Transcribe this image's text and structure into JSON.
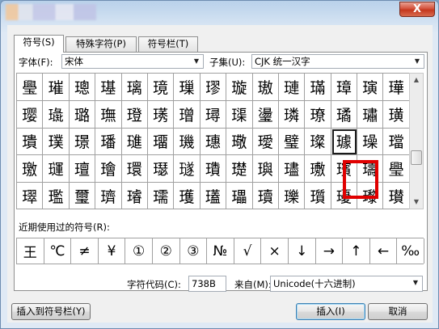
{
  "window": {
    "close_glyph": "X"
  },
  "tabs": [
    {
      "label": "符号(S)"
    },
    {
      "label": "特殊字符(P)"
    },
    {
      "label": "符号栏(T)"
    }
  ],
  "font": {
    "label": "字体(F):",
    "value": "宋体"
  },
  "subset": {
    "label": "子集(U):",
    "value": "CJK 统一汉字"
  },
  "symbols": [
    [
      "璺",
      "璀",
      "璁",
      "璂",
      "璃",
      "璄",
      "璅",
      "璆",
      "璇",
      "璈",
      "璉",
      "璊",
      "璋",
      "璌",
      "璍"
    ],
    [
      "璎",
      "璏",
      "璐",
      "璑",
      "璒",
      "璓",
      "璔",
      "璕",
      "璖",
      "璗",
      "璘",
      "璙",
      "璚",
      "璛",
      "璜"
    ],
    [
      "璝",
      "璞",
      "璟",
      "璠",
      "璡",
      "璢",
      "璣",
      "璤",
      "璥",
      "璦",
      "璧",
      "璨",
      "璩",
      "璪",
      "璫"
    ],
    [
      "璬",
      "璭",
      "璮",
      "璯",
      "環",
      "璱",
      "璲",
      "璳",
      "璴",
      "璵",
      "璶",
      "璷",
      "璸",
      "璹",
      "璺"
    ],
    [
      "璻",
      "璼",
      "璽",
      "璾",
      "璿",
      "瓀",
      "瓁",
      "瓂",
      "瓃",
      "瓄",
      "瓅",
      "瓆",
      "瓇",
      "瓈",
      "瓉"
    ]
  ],
  "selected_symbol": "璩",
  "recent": {
    "label": "近期使用过的符号(R):",
    "items": [
      "王",
      "℃",
      "≠",
      "¥",
      "①",
      "②",
      "③",
      "№",
      "√",
      "×",
      "↓",
      "→",
      "↑",
      "←",
      "‰"
    ]
  },
  "char_code": {
    "label": "字符代码(C):",
    "value": "738B"
  },
  "from": {
    "label": "来自(M):",
    "value": "Unicode(十六进制)"
  },
  "buttons": {
    "insert_to_bar": "插入到符号栏(Y)",
    "insert": "插入(I)",
    "cancel": "取消"
  },
  "colors": {
    "highlight": "#e00000",
    "window_frame": "#b9d1ea"
  }
}
